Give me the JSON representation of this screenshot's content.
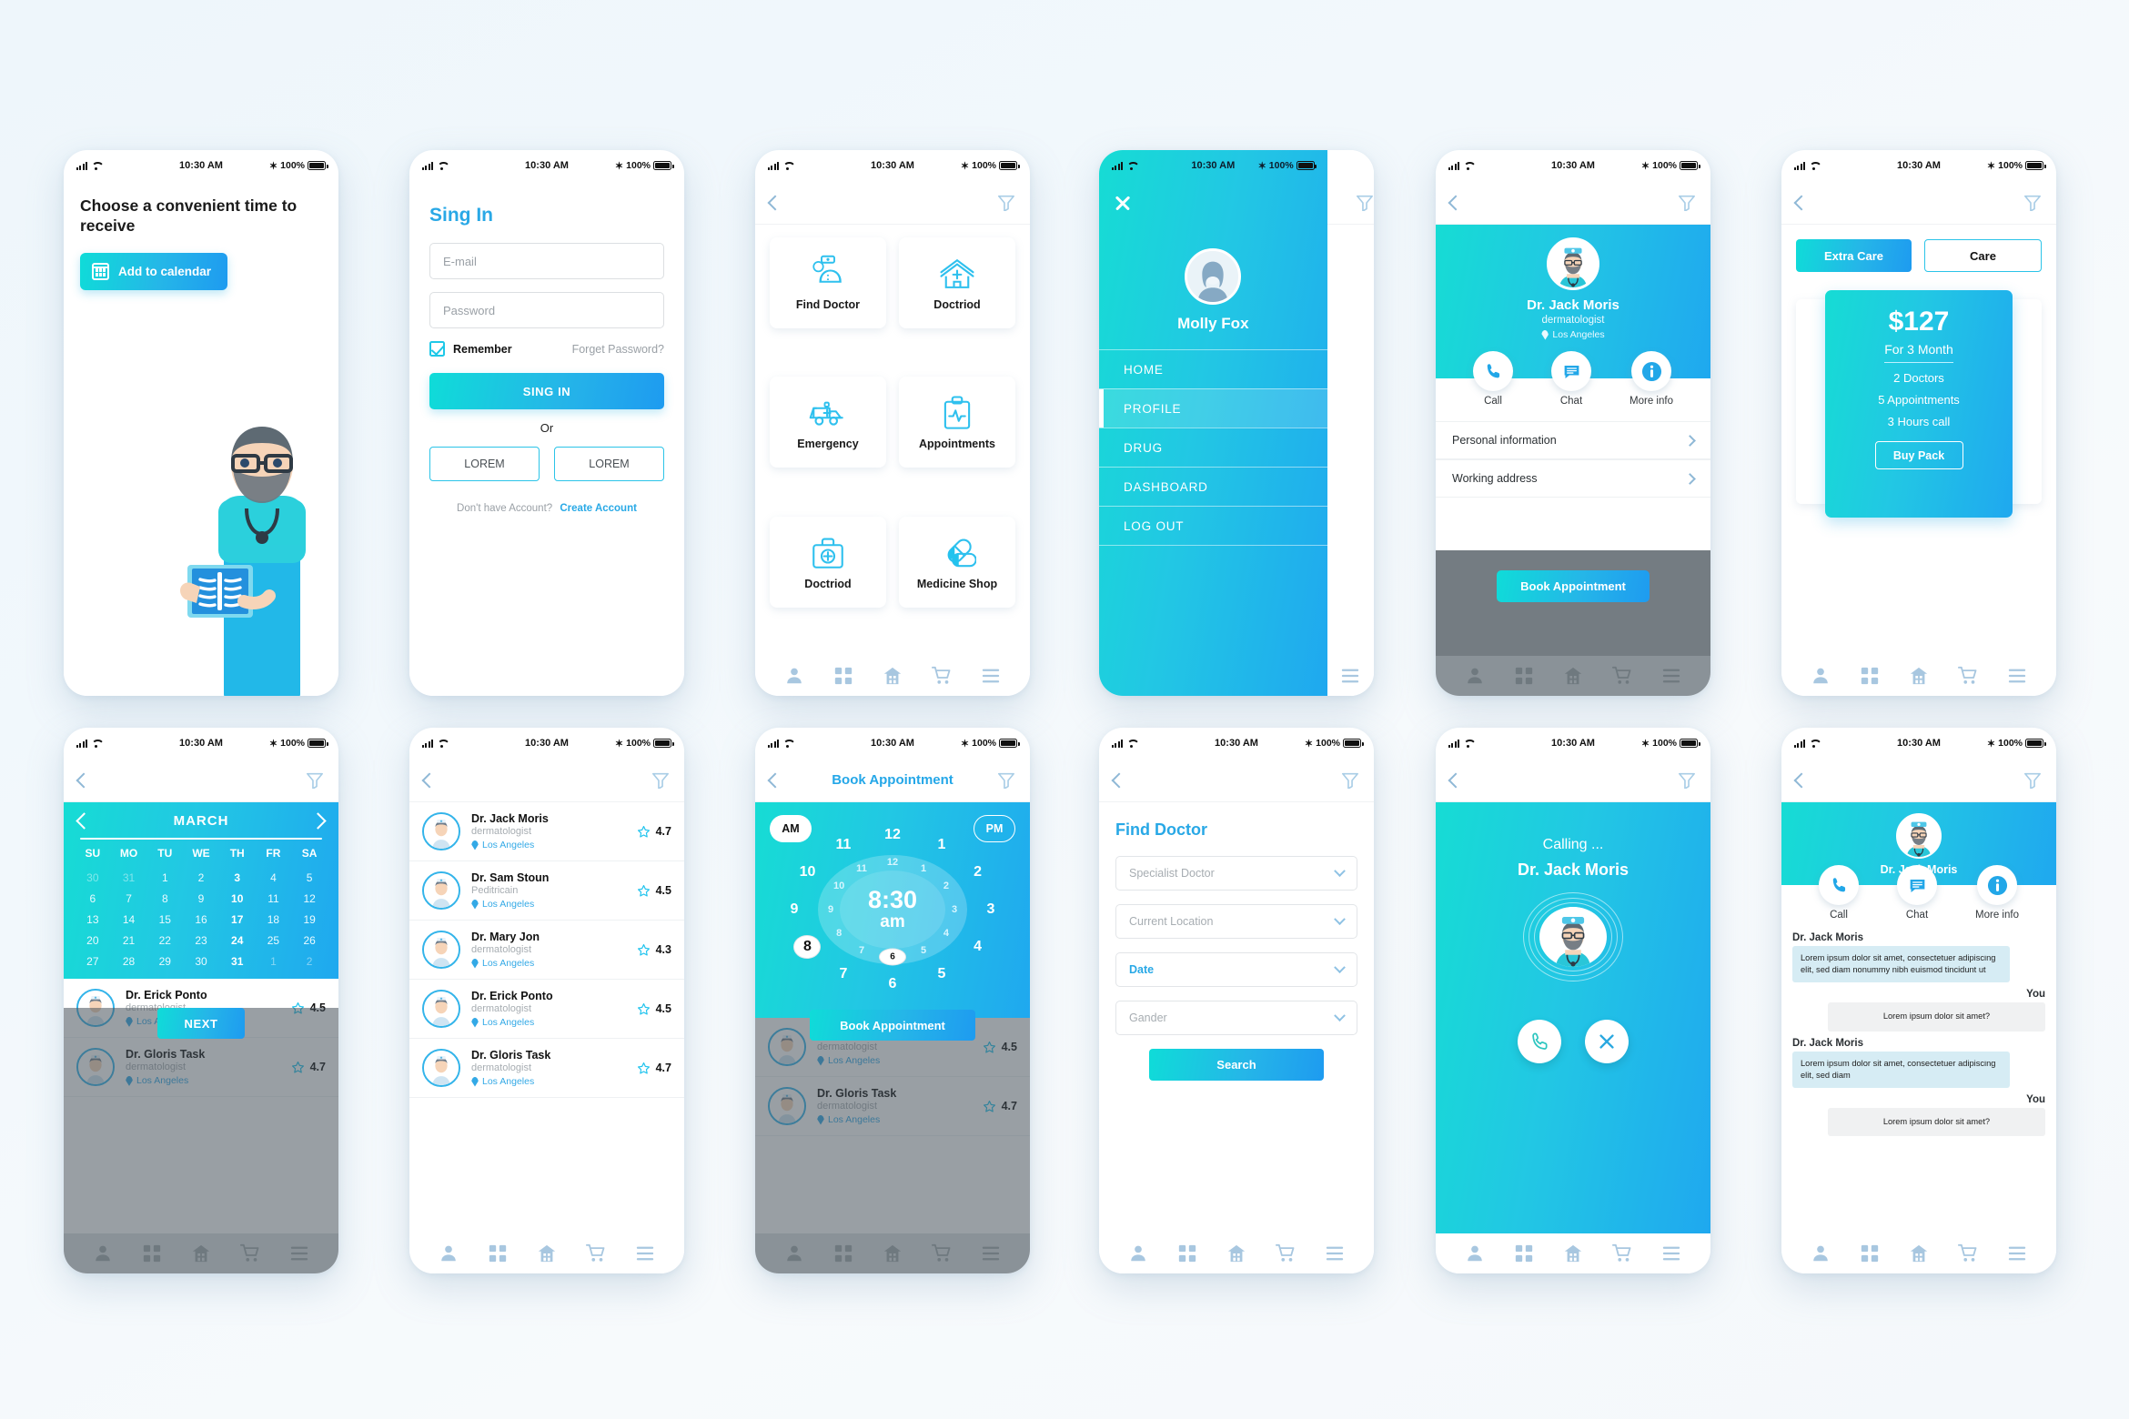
{
  "status_bar": {
    "time": "10:30 AM",
    "battery": "100%",
    "bluetooth": "✶"
  },
  "screens": {
    "onboarding": {
      "title": "Choose a convenient time to receive",
      "cta": "Add to calendar"
    },
    "signin": {
      "heading": "Sing In",
      "email_placeholder": "E-mail",
      "password_placeholder": "Password",
      "remember": "Remember",
      "forgot": "Forget Password?",
      "submit": "SING IN",
      "or": "Or",
      "social_left": "LOREM",
      "social_right": "LOREM",
      "foot_q": "Don't have Account?",
      "foot_a": "Create Account"
    },
    "menu": {
      "tiles": [
        {
          "label": "Find Doctor",
          "icon": "doctor-icon"
        },
        {
          "label": "Doctriod",
          "icon": "hospital-home-icon"
        },
        {
          "label": "Emergency",
          "icon": "ambulance-icon"
        },
        {
          "label": "Appointments",
          "icon": "clipboard-pulse-icon"
        },
        {
          "label": "Doctriod",
          "icon": "first-aid-kit-icon"
        },
        {
          "label": "Medicine Shop",
          "icon": "pills-icon"
        }
      ]
    },
    "drawer": {
      "user": "Molly Fox",
      "items": [
        {
          "label": "HOME",
          "active": false
        },
        {
          "label": "PROFILE",
          "active": true
        },
        {
          "label": "DRUG",
          "active": false
        },
        {
          "label": "DASHBOARD",
          "active": false
        },
        {
          "label": "LOG OUT",
          "active": false
        }
      ]
    },
    "doctor_profile": {
      "name": "Dr. Jack Moris",
      "specialty": "dermatologist",
      "location": "Los Angeles",
      "actions": [
        {
          "label": "Call",
          "icon": "phone-icon"
        },
        {
          "label": "Chat",
          "icon": "chat-icon"
        },
        {
          "label": "More info",
          "icon": "info-icon"
        }
      ],
      "rows": [
        "Personal information",
        "Working address"
      ],
      "cta": "Book Appointment"
    },
    "pricing": {
      "tab_active": "Extra Care",
      "tab_inactive": "Care",
      "price": "$127",
      "period": "For 3 Month",
      "features": [
        "2 Doctors",
        "5 Appointments",
        "3 Hours call"
      ],
      "buy": "Buy Pack"
    },
    "calendar": {
      "month": "MARCH",
      "dow": [
        "SU",
        "MO",
        "TU",
        "WE",
        "TH",
        "FR",
        "SA"
      ],
      "weeks": [
        [
          {
            "d": "30",
            "s": "mute"
          },
          {
            "d": "31",
            "s": "mute"
          },
          {
            "d": "1",
            "s": ""
          },
          {
            "d": "2",
            "s": ""
          },
          {
            "d": "3",
            "s": "hl"
          },
          {
            "d": "4",
            "s": ""
          },
          {
            "d": "5",
            "s": ""
          }
        ],
        [
          {
            "d": "6",
            "s": ""
          },
          {
            "d": "7",
            "s": ""
          },
          {
            "d": "8",
            "s": ""
          },
          {
            "d": "9",
            "s": ""
          },
          {
            "d": "10",
            "s": "hl"
          },
          {
            "d": "11",
            "s": ""
          },
          {
            "d": "12",
            "s": ""
          }
        ],
        [
          {
            "d": "13",
            "s": ""
          },
          {
            "d": "14",
            "s": ""
          },
          {
            "d": "15",
            "s": ""
          },
          {
            "d": "16",
            "s": ""
          },
          {
            "d": "17",
            "s": "hl"
          },
          {
            "d": "18",
            "s": ""
          },
          {
            "d": "19",
            "s": ""
          }
        ],
        [
          {
            "d": "20",
            "s": ""
          },
          {
            "d": "21",
            "s": ""
          },
          {
            "d": "22",
            "s": ""
          },
          {
            "d": "23",
            "s": ""
          },
          {
            "d": "24",
            "s": "hl"
          },
          {
            "d": "25",
            "s": ""
          },
          {
            "d": "26",
            "s": ""
          }
        ],
        [
          {
            "d": "27",
            "s": ""
          },
          {
            "d": "28",
            "s": ""
          },
          {
            "d": "29",
            "s": ""
          },
          {
            "d": "30",
            "s": ""
          },
          {
            "d": "31",
            "s": "hl"
          },
          {
            "d": "1",
            "s": "mute"
          },
          {
            "d": "2",
            "s": "mute"
          }
        ]
      ],
      "next": "NEXT",
      "behind_rows": [
        {
          "name": "Dr. Erick Ponto",
          "specialty": "dermatologist",
          "location": "Los Angeles",
          "rating": "4.5"
        },
        {
          "name": "Dr. Gloris Task",
          "specialty": "dermatologist",
          "location": "Los Angeles",
          "rating": "4.7"
        }
      ]
    },
    "doctor_list": {
      "rows": [
        {
          "name": "Dr. Jack Moris",
          "specialty": "dermatologist",
          "location": "Los Angeles",
          "rating": "4.7"
        },
        {
          "name": "Dr. Sam Stoun",
          "specialty": "Peditricain",
          "location": "Los Angeles",
          "rating": "4.5"
        },
        {
          "name": "Dr. Mary Jon",
          "specialty": "dermatologist",
          "location": "Los Angeles",
          "rating": "4.3"
        },
        {
          "name": "Dr. Erick Ponto",
          "specialty": "dermatologist",
          "location": "Los Angeles",
          "rating": "4.5"
        },
        {
          "name": "Dr. Gloris Task",
          "specialty": "dermatologist",
          "location": "Los Angeles",
          "rating": "4.7"
        }
      ]
    },
    "book_appointment": {
      "title": "Book Appointment",
      "am": "AM",
      "pm": "PM",
      "time": "8:30",
      "meridiem": "am",
      "outer_hours": [
        "12",
        "1",
        "2",
        "3",
        "4",
        "5",
        "6",
        "7",
        "8",
        "9",
        "10",
        "11"
      ],
      "inner_hours": [
        "12",
        "1",
        "2",
        "3",
        "4",
        "5",
        "6",
        "7",
        "8",
        "9",
        "10",
        "11"
      ],
      "selected_outer": "8",
      "selected_inner": "6",
      "cta": "Book Appointment"
    },
    "find_doctor": {
      "heading": "Find Doctor",
      "fields": [
        {
          "label": "Specialist Doctor",
          "filled": false
        },
        {
          "label": "Current Location",
          "filled": false
        },
        {
          "label": "Date",
          "filled": true
        },
        {
          "label": "Gander",
          "filled": false
        }
      ],
      "search": "Search"
    },
    "calling": {
      "status": "Calling ...",
      "name": "Dr. Jack Moris",
      "accept_icon": "phone-icon",
      "decline_icon": "close-icon"
    },
    "chat": {
      "name": "Dr. Jack Moris",
      "actions": [
        {
          "label": "Call",
          "icon": "phone-icon"
        },
        {
          "label": "Chat",
          "icon": "chat-icon"
        },
        {
          "label": "More info",
          "icon": "info-icon"
        }
      ],
      "messages": [
        {
          "sender": "Dr. Jack Moris",
          "side": "them",
          "text": "Lorem ipsum dolor sit amet, consectetuer adipiscing elit, sed diam nonummy nibh euismod tincidunt ut"
        },
        {
          "sender": "You",
          "side": "me",
          "text": "Lorem ipsum dolor sit amet?"
        },
        {
          "sender": "Dr. Jack Moris",
          "side": "them",
          "text": "Lorem ipsum dolor sit amet, consectetuer adipiscing elit, sed diam"
        },
        {
          "sender": "You",
          "side": "me",
          "text": "Lorem ipsum dolor sit amet?"
        }
      ]
    }
  },
  "tabbar": {
    "items": [
      "profile-icon",
      "grid-icon",
      "hospital-icon",
      "cart-icon",
      "menu-icon"
    ]
  },
  "colors": {
    "accent": "#28a8e6",
    "accent_cyan": "#16dcd4",
    "gradient_start": "#16dcd4",
    "gradient_end": "#1fa8ef",
    "muted_text": "#a7adb2",
    "dim_overlay": "#565f67"
  }
}
